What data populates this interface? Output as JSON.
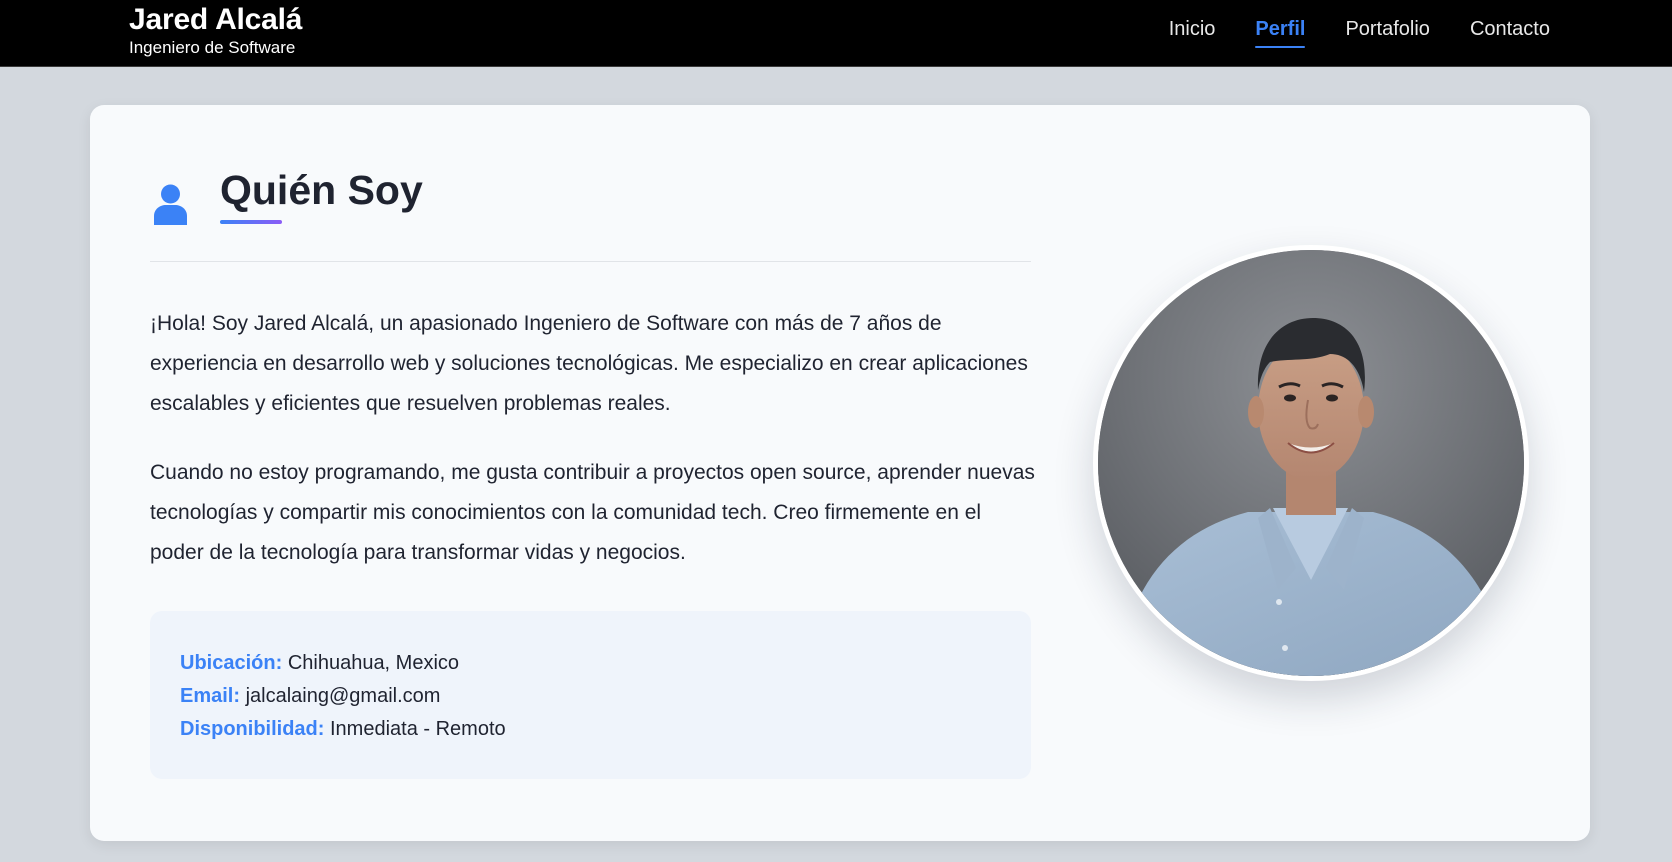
{
  "header": {
    "name": "Jared Alcalá",
    "subtitle": "Ingeniero de Software",
    "nav": [
      {
        "label": "Inicio"
      },
      {
        "label": "Perfil",
        "active": true
      },
      {
        "label": "Portafolio"
      },
      {
        "label": "Contacto"
      }
    ]
  },
  "about": {
    "icon": "user-icon",
    "title": "Quién Soy",
    "paragraphs": [
      "¡Hola! Soy Jared Alcalá, un apasionado Ingeniero de Software con más de 7 años de experiencia en desarrollo web y soluciones tecnológicas. Me especializo en crear aplicaciones escalables y eficientes que resuelven problemas reales.",
      "Cuando no estoy programando, me gusta contribuir a proyectos open source, aprender nuevas tecnologías y compartir mis conocimientos con la comunidad tech. Creo firmemente en el poder de la tecnología para transformar vidas y negocios."
    ],
    "info": [
      {
        "label": "Ubicación:",
        "value": "Chihuahua, Mexico"
      },
      {
        "label": "Email:",
        "value": "jalcalaing@gmail.com"
      },
      {
        "label": "Disponibilidad:",
        "value": "Inmediata - Remoto"
      }
    ]
  },
  "colors": {
    "accent": "#3b82f6",
    "accent_gradient_end": "#8b5cf6",
    "topbar": "#000000",
    "page_background": "#d3d8de",
    "card_background": "#f8fafc"
  }
}
